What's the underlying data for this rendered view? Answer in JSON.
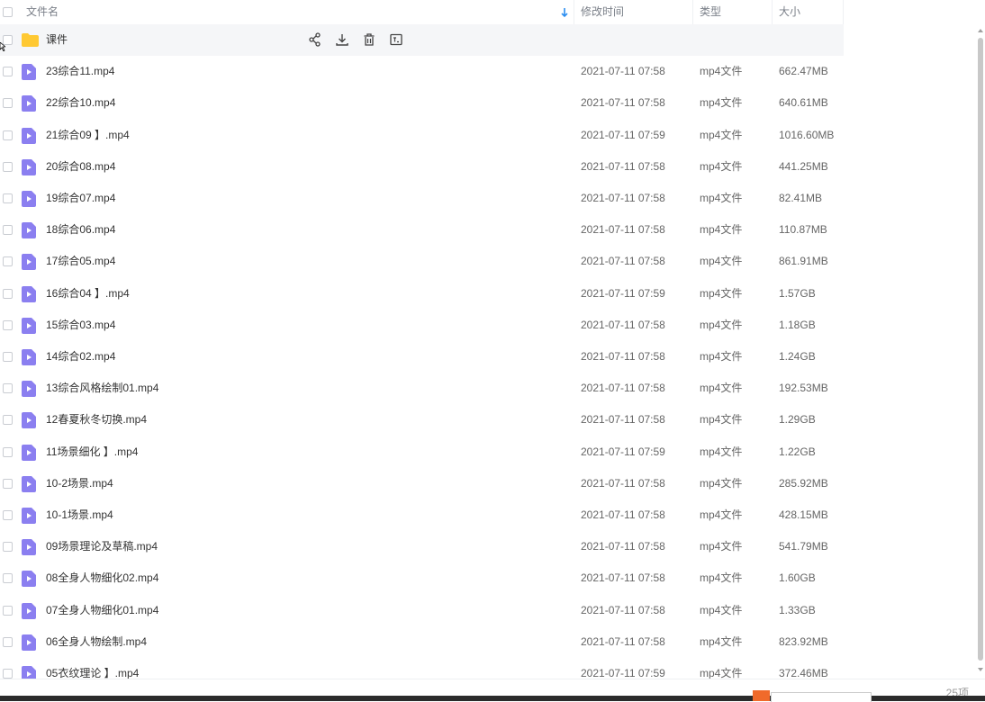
{
  "header": {
    "name_label": "文件名",
    "modified_label": "修改时间",
    "type_label": "类型",
    "size_label": "大小",
    "sort_icon": "sort-down-arrow-icon"
  },
  "colors": {
    "accent": "#2b8ef0",
    "video_icon": "#8b7ff0",
    "folder": "#ffc933"
  },
  "rows": [
    {
      "name": "课件",
      "date": "",
      "type": "",
      "size": "",
      "kind": "folder"
    },
    {
      "name": "23综合11.mp4",
      "date": "2021-07-11 07:58",
      "type": "mp4文件",
      "size": "662.47MB",
      "kind": "video"
    },
    {
      "name": "22综合10.mp4",
      "date": "2021-07-11 07:58",
      "type": "mp4文件",
      "size": "640.61MB",
      "kind": "video"
    },
    {
      "name": "21综合09 】.mp4",
      "date": "2021-07-11 07:59",
      "type": "mp4文件",
      "size": "1016.60MB",
      "kind": "video"
    },
    {
      "name": "20综合08.mp4",
      "date": "2021-07-11 07:58",
      "type": "mp4文件",
      "size": "441.25MB",
      "kind": "video"
    },
    {
      "name": "19综合07.mp4",
      "date": "2021-07-11 07:58",
      "type": "mp4文件",
      "size": "82.41MB",
      "kind": "video"
    },
    {
      "name": "18综合06.mp4",
      "date": "2021-07-11 07:58",
      "type": "mp4文件",
      "size": "110.87MB",
      "kind": "video"
    },
    {
      "name": "17综合05.mp4",
      "date": "2021-07-11 07:58",
      "type": "mp4文件",
      "size": "861.91MB",
      "kind": "video"
    },
    {
      "name": "16综合04 】.mp4",
      "date": "2021-07-11 07:59",
      "type": "mp4文件",
      "size": "1.57GB",
      "kind": "video"
    },
    {
      "name": "15综合03.mp4",
      "date": "2021-07-11 07:58",
      "type": "mp4文件",
      "size": "1.18GB",
      "kind": "video"
    },
    {
      "name": "14综合02.mp4",
      "date": "2021-07-11 07:58",
      "type": "mp4文件",
      "size": "1.24GB",
      "kind": "video"
    },
    {
      "name": "13综合风格绘制01.mp4",
      "date": "2021-07-11 07:58",
      "type": "mp4文件",
      "size": "192.53MB",
      "kind": "video"
    },
    {
      "name": "12春夏秋冬切换.mp4",
      "date": "2021-07-11 07:58",
      "type": "mp4文件",
      "size": "1.29GB",
      "kind": "video"
    },
    {
      "name": "11场景细化 】.mp4",
      "date": "2021-07-11 07:59",
      "type": "mp4文件",
      "size": "1.22GB",
      "kind": "video"
    },
    {
      "name": "10-2场景.mp4",
      "date": "2021-07-11 07:58",
      "type": "mp4文件",
      "size": "285.92MB",
      "kind": "video"
    },
    {
      "name": "10-1场景.mp4",
      "date": "2021-07-11 07:58",
      "type": "mp4文件",
      "size": "428.15MB",
      "kind": "video"
    },
    {
      "name": "09场景理论及草稿.mp4",
      "date": "2021-07-11 07:58",
      "type": "mp4文件",
      "size": "541.79MB",
      "kind": "video"
    },
    {
      "name": "08全身人物细化02.mp4",
      "date": "2021-07-11 07:58",
      "type": "mp4文件",
      "size": "1.60GB",
      "kind": "video"
    },
    {
      "name": "07全身人物细化01.mp4",
      "date": "2021-07-11 07:58",
      "type": "mp4文件",
      "size": "1.33GB",
      "kind": "video"
    },
    {
      "name": "06全身人物绘制.mp4",
      "date": "2021-07-11 07:58",
      "type": "mp4文件",
      "size": "823.92MB",
      "kind": "video"
    },
    {
      "name": "05衣纹理论 】.mp4",
      "date": "2021-07-11 07:59",
      "type": "mp4文件",
      "size": "372.46MB",
      "kind": "video"
    }
  ],
  "footer": {
    "count": "25项"
  }
}
